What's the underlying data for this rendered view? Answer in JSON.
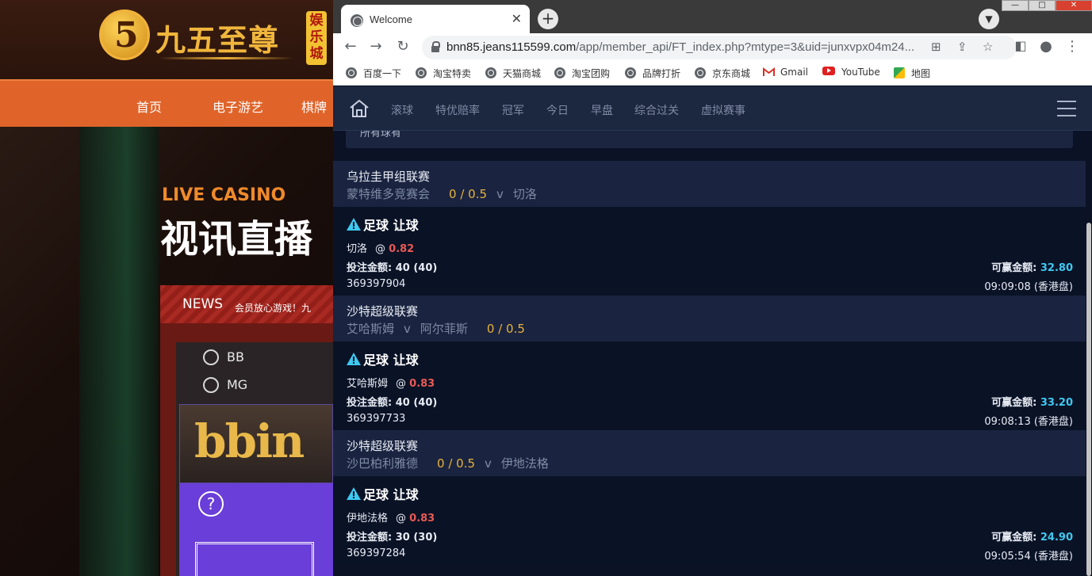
{
  "background_site": {
    "logo_numeral": "5",
    "logo_text": "九五至尊",
    "logo_tag": "娱乐城",
    "nav": [
      "首页",
      "电子游艺",
      "棋牌"
    ],
    "hero_kicker": "LIVE CASINO",
    "hero_title": "视讯直播",
    "news_label": "NEWS",
    "news_text": "会员放心游戏！九",
    "providers": [
      "BB",
      "MG"
    ],
    "bbin_logo": "bbin",
    "help_icon": "?"
  },
  "browser": {
    "tab_title": "Welcome",
    "tab_close": "✕",
    "new_tab": "+",
    "url_host": "bnn85.jeans115599.com",
    "url_rest": "/app/member_api/FT_index.php?mtype=3&uid=junxvpx04m24...",
    "window_controls": [
      "—",
      "□",
      "✕"
    ],
    "bookmarks": [
      "百度一下",
      "淘宝特卖",
      "天猫商城",
      "淘宝团购",
      "品牌打折",
      "京东商城",
      "Gmail",
      "YouTube",
      "地图"
    ]
  },
  "site_nav": {
    "items": [
      "滚球",
      "特优赔率",
      "冠军",
      "今日",
      "早盘",
      "综合过关",
      "虚拟赛事"
    ]
  },
  "filter": {
    "text": "所有球有"
  },
  "bets": [
    {
      "league": "乌拉圭甲组联赛",
      "home": "蒙特维多竞赛会",
      "handicap": "0 / 0.5",
      "vs": "v",
      "away": "切洛",
      "handicap_after_home": true,
      "title": "足球 让球",
      "pick": "切洛",
      "odds": "0.82",
      "stake_label": "投注金额:",
      "stake": "40 (40)",
      "win_label": "可赢金额:",
      "win_value": "32.80",
      "ticket": "369397904",
      "time": "09:09:08 (香港盘)"
    },
    {
      "league": "沙特超级联赛",
      "home": "艾哈斯姆",
      "handicap": "0 / 0.5",
      "vs": "v",
      "away": "阿尔菲斯",
      "handicap_after_home": false,
      "title": "足球 让球",
      "pick": "艾哈斯姆",
      "odds": "0.83",
      "stake_label": "投注金额:",
      "stake": "40 (40)",
      "win_label": "可赢金额:",
      "win_value": "33.20",
      "ticket": "369397733",
      "time": "09:08:13 (香港盘)"
    },
    {
      "league": "沙特超级联赛",
      "home": "沙巴柏利雅德",
      "handicap": "0 / 0.5",
      "vs": "v",
      "away": "伊地法格",
      "handicap_after_home": true,
      "title": "足球 让球",
      "pick": "伊地法格",
      "odds": "0.83",
      "stake_label": "投注金额:",
      "stake": "30 (30)",
      "win_label": "可赢金额:",
      "win_value": "24.90",
      "ticket": "369397284",
      "time": "09:05:54 (香港盘)"
    }
  ],
  "colors": {
    "odds": "#e85a54",
    "win_value": "#3ec8f0",
    "handicap": "#e8b23a",
    "warning_icon": "#3ec8f0"
  },
  "icons": [
    "home-icon",
    "menu-icon",
    "warning-icon",
    "lock-icon",
    "reload-icon",
    "back-icon",
    "forward-icon",
    "star-icon",
    "share-icon",
    "translate-icon",
    "profile-icon",
    "kebab-icon"
  ]
}
